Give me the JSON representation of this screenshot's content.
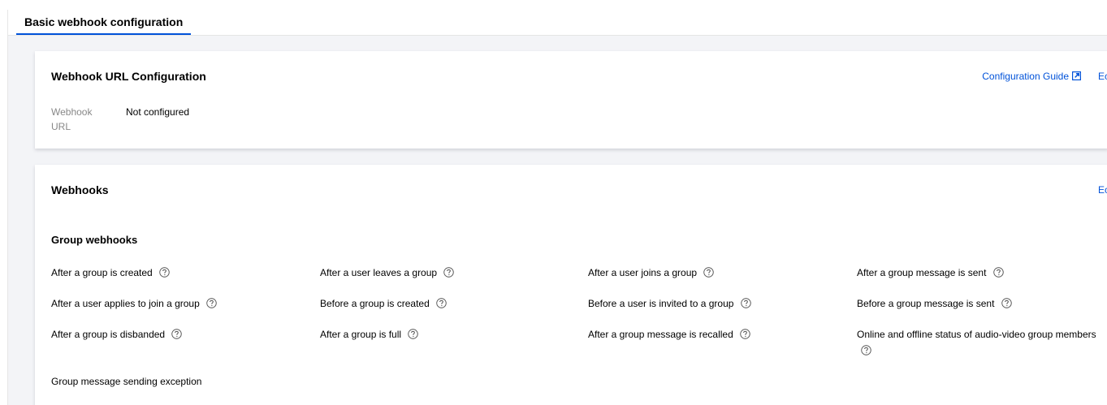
{
  "tabs": [
    {
      "label": "Basic webhook configuration",
      "active": true
    }
  ],
  "url_card": {
    "title": "Webhook URL Configuration",
    "guide_link": "Configuration Guide",
    "edit_link": "Ec",
    "field_label": "Webhook URL",
    "field_value": "Not configured"
  },
  "webhooks_card": {
    "title": "Webhooks",
    "edit_link": "Ec",
    "section_title": "Group webhooks",
    "items": [
      {
        "label": "After a group is created",
        "help": true
      },
      {
        "label": "After a user leaves a group",
        "help": true
      },
      {
        "label": "After a user joins a group",
        "help": true
      },
      {
        "label": "After a group message is sent",
        "help": true
      },
      {
        "label": "After a user applies to join a group",
        "help": true
      },
      {
        "label": "Before a group is created",
        "help": true
      },
      {
        "label": "Before a user is invited to a group",
        "help": true
      },
      {
        "label": "Before a group message is sent",
        "help": true
      },
      {
        "label": "After a group is disbanded",
        "help": true
      },
      {
        "label": "After a group is full",
        "help": true
      },
      {
        "label": "After a group message is recalled",
        "help": true
      },
      {
        "label": "Online and offline status of audio-video group members",
        "help": true
      },
      {
        "label": "Group message sending exception",
        "help": false
      }
    ]
  },
  "colors": {
    "accent": "#0052d9",
    "background": "#f3f4f7",
    "muted_text": "#888888"
  },
  "icons": {
    "external_link": "external-link-icon",
    "help": "help-circle-icon"
  }
}
